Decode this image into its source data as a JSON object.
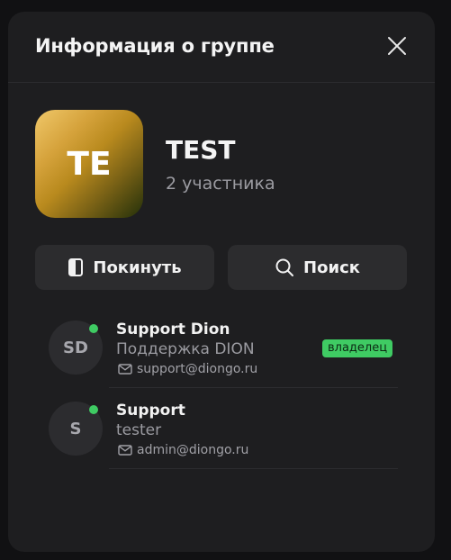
{
  "header": {
    "title": "Информация о группе"
  },
  "group": {
    "avatar_initials": "TE",
    "name": "TEST",
    "members_count": "2 участника"
  },
  "actions": {
    "leave_label": "Покинуть",
    "search_label": "Поиск"
  },
  "members": [
    {
      "initials": "SD",
      "name": "Support Dion",
      "role": "Поддержка DION",
      "email": "support@diongo.ru",
      "badge": "владелец",
      "online": true
    },
    {
      "initials": "S",
      "name": "Support",
      "role": "tester",
      "email": "admin@diongo.ru",
      "online": true
    }
  ],
  "colors": {
    "online": "#3fcb63",
    "badge_bg": "#3fcb63",
    "panel_bg": "#1e1e20",
    "button_bg": "#2c2c2e"
  },
  "icons": {
    "close": "close-icon",
    "leave": "door-exit-icon",
    "search": "search-icon",
    "email": "mail-icon"
  }
}
